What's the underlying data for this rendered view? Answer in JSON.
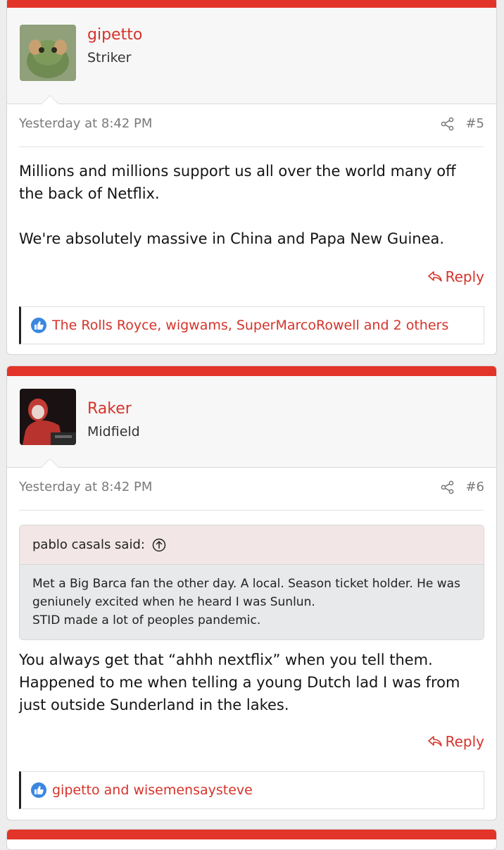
{
  "posts": [
    {
      "username": "gipetto",
      "user_title": "Striker",
      "date": "Yesterday at 8:42 PM",
      "post_number": "#5",
      "paragraphs": [
        "Millions and millions support us all over the world many off the back of Netflix.",
        "We're absolutely massive in China and Papa New Guinea."
      ],
      "reply_label": "Reply",
      "likes_text": "The Rolls Royce, wigwams, SuperMarcoRowell and 2 others"
    },
    {
      "username": "Raker",
      "user_title": "Midfield",
      "date": "Yesterday at 8:42 PM",
      "post_number": "#6",
      "quote": {
        "author": "pablo casals said:",
        "lines": [
          "Met a Big Barca fan the other day. A local. Season ticket holder. He was geniunely excited when he heard I was Sunlun.",
          "STID made a lot of peoples pandemic."
        ]
      },
      "paragraphs": [
        "You always get that “ahhh nextflix” when you tell them. Happened to me when telling a young Dutch lad I was from just outside Sunderland in the lakes."
      ],
      "reply_label": "Reply",
      "likes_text": "gipetto and wisemensaysteve"
    }
  ],
  "colors": {
    "accent": "#e3342a",
    "link": "#d6332a",
    "like": "#3a87e0"
  }
}
